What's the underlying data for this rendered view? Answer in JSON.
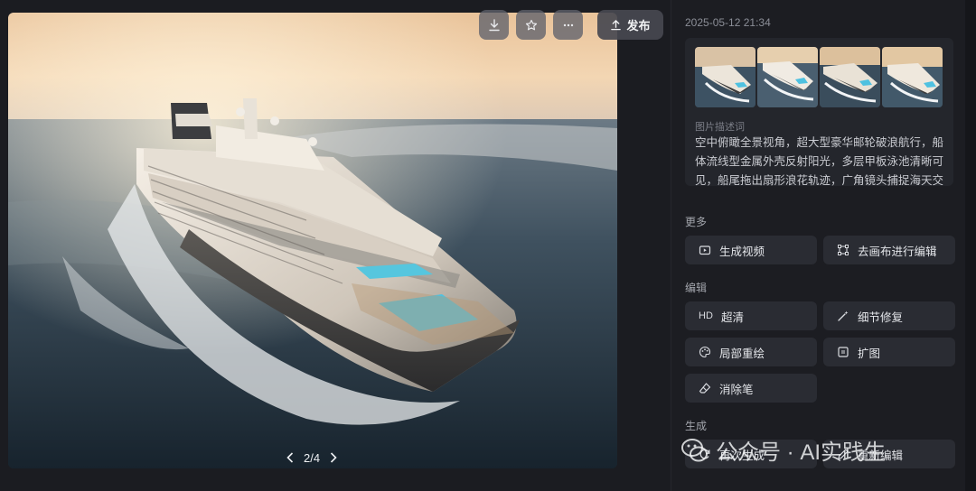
{
  "toolbar": {
    "download_icon": "download-icon",
    "star_icon": "star-icon",
    "more_icon": "more-icon",
    "publish_label": "发布"
  },
  "pager": {
    "current": "2/4"
  },
  "sidebar": {
    "timestamp": "2025-05-12 21:34",
    "desc_label": "图片描述词",
    "desc_text": "空中俯瞰全景视角，超大型豪华邮轮破浪航行，船体流线型金属外壳反射阳光，多层甲板泳池清晰可见，船尾拖出扇形浪花轨迹，广角镜头捕捉海天交界处的",
    "sections": {
      "more": "更多",
      "edit": "编辑",
      "generate": "生成"
    },
    "buttons": {
      "gen_video": "生成视频",
      "canvas_edit": "去画布进行编辑",
      "hd_prefix": "HD",
      "super_res": "超清",
      "detail_fix": "细节修复",
      "inpaint": "局部重绘",
      "expand": "扩图",
      "eraser": "消除笔",
      "regen": "再次生成",
      "reedit": "重新编辑"
    }
  },
  "watermark": {
    "text": "公众号 · AI实践生"
  }
}
